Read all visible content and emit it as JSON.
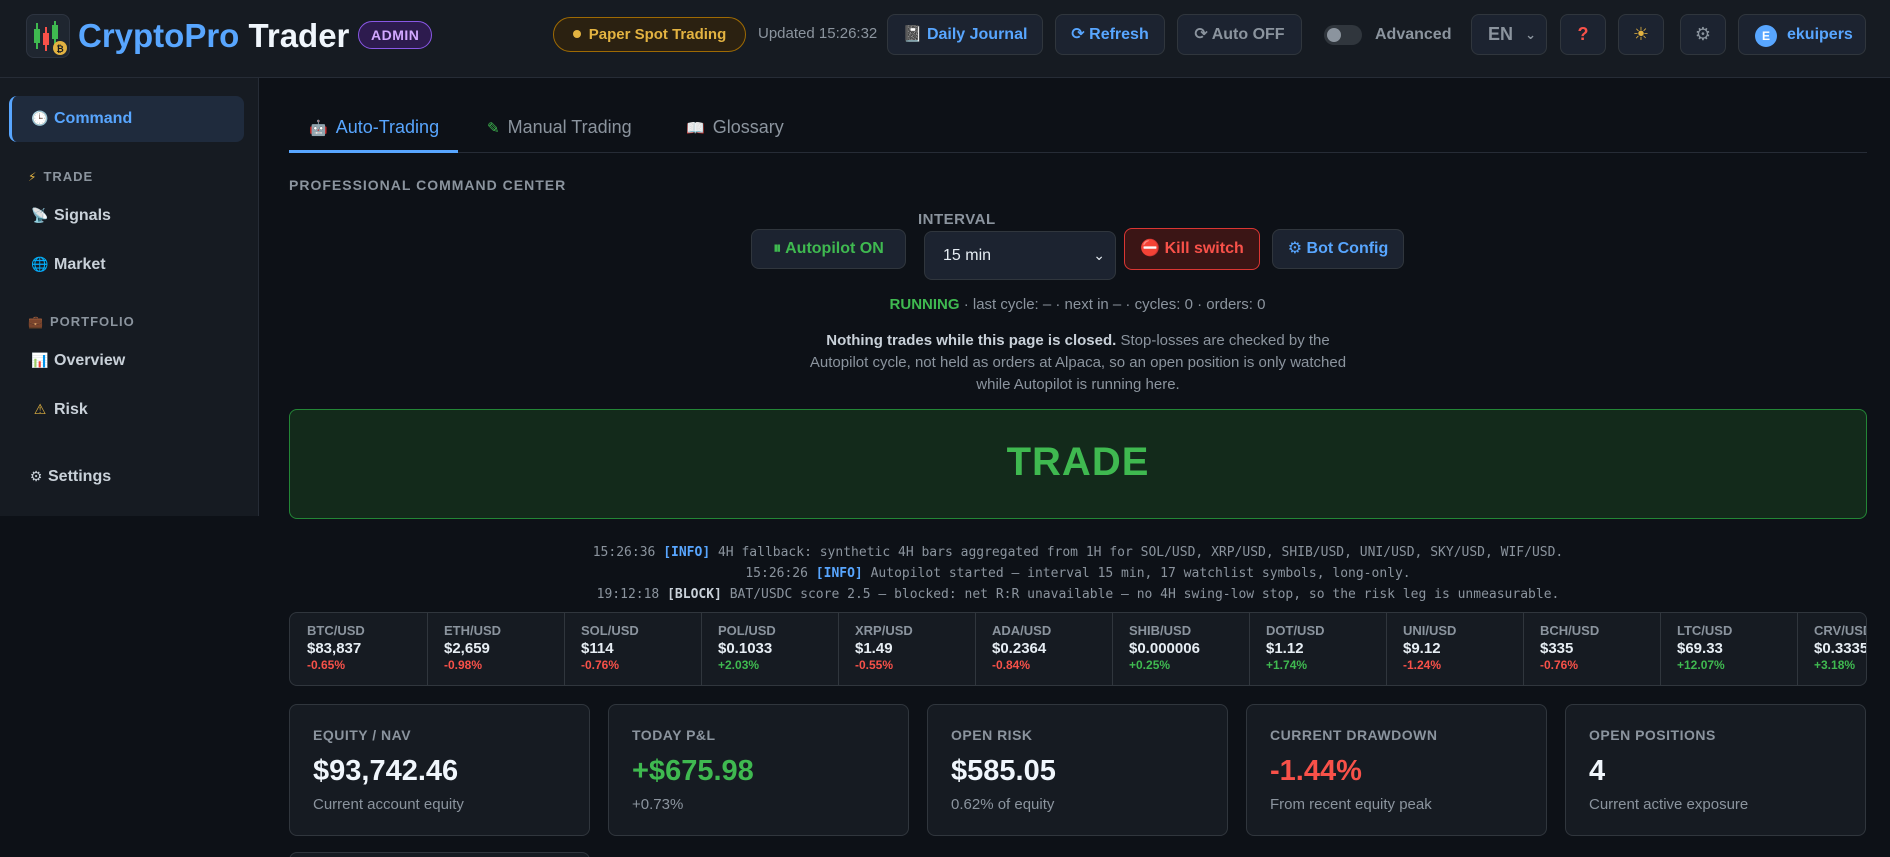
{
  "header": {
    "brand_part1": "CryptoPro",
    "brand_part2": "Trader",
    "admin_badge": "ADMIN",
    "mode_badge": "Paper Spot Trading",
    "updated": "Updated 15:26:32",
    "journal_button": "Daily Journal",
    "refresh_button": "Refresh",
    "auto_button": "Auto OFF",
    "advanced_label": "Advanced",
    "language": "EN",
    "help_icon": "?",
    "theme_icon": "☀",
    "settings_icon": "⚙",
    "user_initial": "E",
    "username": "ekuipers"
  },
  "sidebar": {
    "command": "Command",
    "trade_section": "TRADE",
    "signals": "Signals",
    "market": "Market",
    "portfolio_section": "PORTFOLIO",
    "overview": "Overview",
    "risk": "Risk",
    "settings": "Settings"
  },
  "tabs": {
    "auto": "Auto-Trading",
    "manual": "Manual Trading",
    "glossary": "Glossary"
  },
  "command_center": {
    "title": "PROFESSIONAL COMMAND CENTER",
    "autopilot_button": "Autopilot ON",
    "interval_label": "INTERVAL",
    "interval_value": "15 min",
    "kill_button": "Kill switch",
    "botconfig_button": "Bot Config",
    "status_running": "RUNNING",
    "status_rest": " · last cycle: – · next in – · cycles: 0 · orders: 0",
    "warning_bold": "Nothing trades while this page is closed.",
    "warning_rest": " Stop-losses are checked by the Autopilot cycle, not held as orders at Alpaca, so an open position is only watched while Autopilot is running here.",
    "trade_signal": "TRADE"
  },
  "logs": [
    {
      "time": "15:26:36",
      "tag": "[INFO]",
      "msg": "4H fallback: synthetic 4H bars aggregated from 1H for SOL/USD, XRP/USD, SHIB/USD, UNI/USD, SKY/USD, WIF/USD."
    },
    {
      "time": "15:26:26",
      "tag": "[INFO]",
      "msg": "Autopilot started — interval 15 min, 17 watchlist symbols, long-only."
    },
    {
      "time": "19:12:18",
      "tag": "[BLOCK]",
      "msg": "BAT/USDC score 2.5 — blocked: net R:R unavailable — no 4H swing-low stop, so the risk leg is unmeasurable."
    }
  ],
  "ticker": [
    {
      "sym": "BTC/USD",
      "price": "$83,837",
      "chg": "-0.65%",
      "dir": "neg"
    },
    {
      "sym": "ETH/USD",
      "price": "$2,659",
      "chg": "-0.98%",
      "dir": "neg"
    },
    {
      "sym": "SOL/USD",
      "price": "$114",
      "chg": "-0.76%",
      "dir": "neg"
    },
    {
      "sym": "POL/USD",
      "price": "$0.1033",
      "chg": "+2.03%",
      "dir": "pos"
    },
    {
      "sym": "XRP/USD",
      "price": "$1.49",
      "chg": "-0.55%",
      "dir": "neg"
    },
    {
      "sym": "ADA/USD",
      "price": "$0.2364",
      "chg": "-0.84%",
      "dir": "neg"
    },
    {
      "sym": "SHIB/USD",
      "price": "$0.000006",
      "chg": "+0.25%",
      "dir": "pos"
    },
    {
      "sym": "DOT/USD",
      "price": "$1.12",
      "chg": "+1.74%",
      "dir": "pos"
    },
    {
      "sym": "UNI/USD",
      "price": "$9.12",
      "chg": "-1.24%",
      "dir": "neg"
    },
    {
      "sym": "BCH/USD",
      "price": "$335",
      "chg": "-0.76%",
      "dir": "neg"
    },
    {
      "sym": "LTC/USD",
      "price": "$69.33",
      "chg": "+12.07%",
      "dir": "pos"
    },
    {
      "sym": "CRV/USD",
      "price": "$0.3335",
      "chg": "+3.18%",
      "dir": "pos"
    }
  ],
  "kpis": [
    {
      "label": "EQUITY / NAV",
      "value": "$93,742.46",
      "sub": "Current account equity",
      "tone": ""
    },
    {
      "label": "TODAY P&L",
      "value": "+$675.98",
      "sub": "+0.73%",
      "tone": "pos"
    },
    {
      "label": "OPEN RISK",
      "value": "$585.05",
      "sub": "0.62% of equity",
      "tone": ""
    },
    {
      "label": "CURRENT DRAWDOWN",
      "value": "-1.44%",
      "sub": "From recent equity peak",
      "tone": "neg"
    },
    {
      "label": "OPEN POSITIONS",
      "value": "4",
      "sub": "Current active exposure",
      "tone": ""
    }
  ],
  "colors": {
    "background": "#0d1117",
    "panel": "#161b22",
    "accent_blue": "#58a6ff",
    "positive_green": "#3fb950",
    "negative_red": "#f85149",
    "warning_amber": "#e3b341",
    "admin_purple": "#d2a8ff"
  },
  "icons": {
    "logo": "candlestick-chart-icon",
    "journal": "notebook-icon",
    "refresh": "refresh-icon",
    "auto": "sync-icon",
    "command": "clock-icon",
    "trade": "lightning-icon",
    "signals": "satellite-dish-icon",
    "market": "globe-icon",
    "portfolio": "briefcase-icon",
    "overview": "bar-chart-icon",
    "risk": "warning-icon",
    "settings": "gear-icon"
  }
}
